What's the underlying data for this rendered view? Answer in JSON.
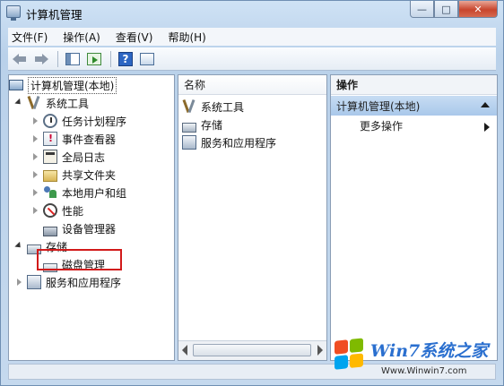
{
  "window": {
    "title": "计算机管理",
    "buttons": {
      "minimize": "—",
      "maximize": "□",
      "close": "✕"
    }
  },
  "menu": [
    "文件(F)",
    "操作(A)",
    "查看(V)",
    "帮助(H)"
  ],
  "toolbar": {
    "icons": [
      "back-arrow-icon",
      "forward-arrow-icon",
      "show-hide-tree-icon",
      "export-list-icon",
      "help-icon",
      "show-hide-action-pane-icon"
    ],
    "help_glyph": "?"
  },
  "tree": {
    "root": "计算机管理(本地)",
    "system_tools": "系统工具",
    "task_scheduler": "任务计划程序",
    "event_viewer": "事件查看器",
    "global_log": "全局日志",
    "shared_folders": "共享文件夹",
    "local_users": "本地用户和组",
    "performance": "性能",
    "device_manager": "设备管理器",
    "storage": "存储",
    "disk_management": "磁盘管理",
    "services_apps": "服务和应用程序"
  },
  "middle": {
    "column_header": "名称",
    "items": [
      "系统工具",
      "存储",
      "服务和应用程序"
    ]
  },
  "actions": {
    "header": "操作",
    "group": "计算机管理(本地)",
    "more": "更多操作"
  },
  "watermark": {
    "title": "Win7系统之家",
    "url": "Www.Winwin7.com"
  },
  "colors": {
    "highlight_box": "#d21a1a",
    "action_group_bg": "#b5d0ee"
  }
}
